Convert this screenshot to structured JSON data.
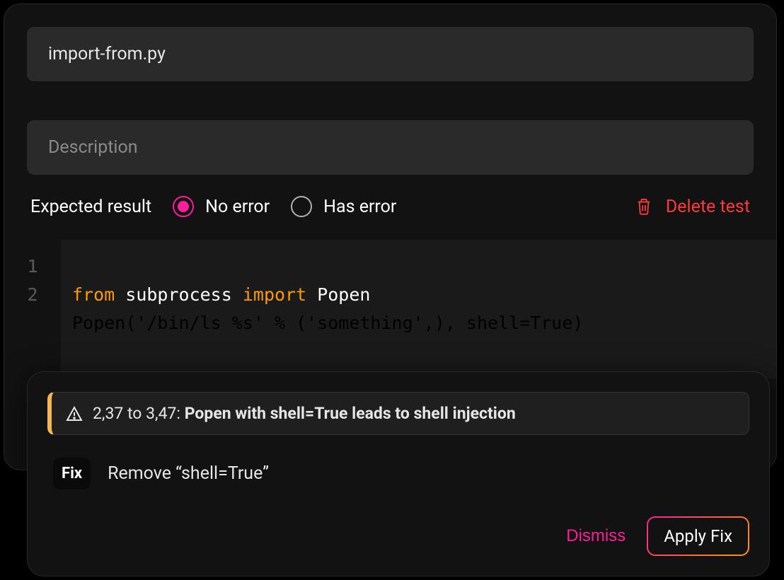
{
  "filename": {
    "value": "import-from.py"
  },
  "description": {
    "placeholder": "Description"
  },
  "expected": {
    "label": "Expected result",
    "options": {
      "no_error": "No error",
      "has_error": "Has error"
    },
    "selected": "no_error"
  },
  "delete": {
    "label": "Delete test"
  },
  "code": {
    "lines": [
      {
        "n": "1",
        "tokens": [
          {
            "t": "from ",
            "c": "kw"
          },
          {
            "t": "subprocess ",
            "c": "id"
          },
          {
            "t": "import ",
            "c": "kw"
          },
          {
            "t": "Popen",
            "c": "id"
          }
        ]
      },
      {
        "n": "2",
        "raw": "Popen('/bin/ls %s' % ('something',), shell=True)"
      }
    ]
  },
  "diagnostic": {
    "range": "2,37 to 3,47: ",
    "message": "Popen with shell=True leads to shell injection"
  },
  "fix": {
    "badge": "Fix",
    "description": "Remove “shell=True”"
  },
  "actions": {
    "dismiss": "Dismiss",
    "apply": "Apply Fix"
  }
}
